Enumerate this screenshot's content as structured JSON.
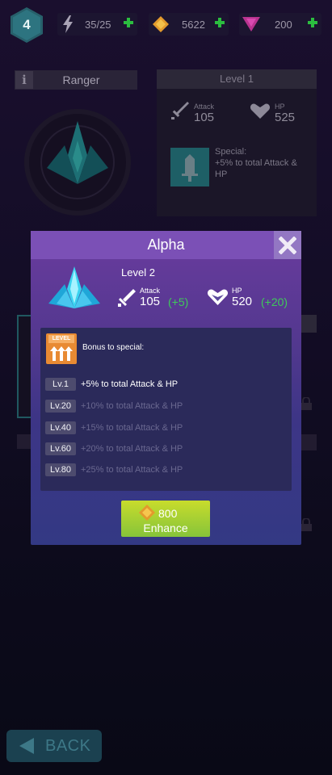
{
  "topbar": {
    "player_level": "4",
    "energy": "35/25",
    "gold": "5622",
    "gems": "200",
    "plus_color": "#2bbd3f",
    "icons": [
      "bolt-icon",
      "gold-coin-icon",
      "gem-icon",
      "plus-icon"
    ]
  },
  "background": {
    "ship_class": "Ranger",
    "level_tab": "Level 1",
    "attack_label": "Attack",
    "attack_value": "105",
    "hp_label": "HP",
    "hp_value": "525",
    "special_label": "Special:",
    "special_text": "+5% to total Attack & HP"
  },
  "modal": {
    "title": "Alpha",
    "level": "Level 2",
    "attack_label": "Attack",
    "attack_value": "105",
    "attack_bonus": "(+5)",
    "hp_label": "HP",
    "hp_value": "520",
    "hp_bonus": "(+20)",
    "badge_text": "LEVEL",
    "bonus_title": "Bonus to special:",
    "bonus_rows": [
      {
        "level": "Lv.1",
        "text": "+5% to total Attack & HP",
        "active": true
      },
      {
        "level": "Lv.20",
        "text": "+10% to total Attack & HP",
        "active": false
      },
      {
        "level": "Lv.40",
        "text": "+15% to total Attack & HP",
        "active": false
      },
      {
        "level": "Lv.60",
        "text": "+20% to total Attack & HP",
        "active": false
      },
      {
        "level": "Lv.80",
        "text": "+25% to total Attack & HP",
        "active": false
      }
    ],
    "enhance_cost": "800",
    "enhance_label": "Enhance",
    "bonus_color": "#3fc95a"
  },
  "back_button": {
    "label": "BACK"
  }
}
